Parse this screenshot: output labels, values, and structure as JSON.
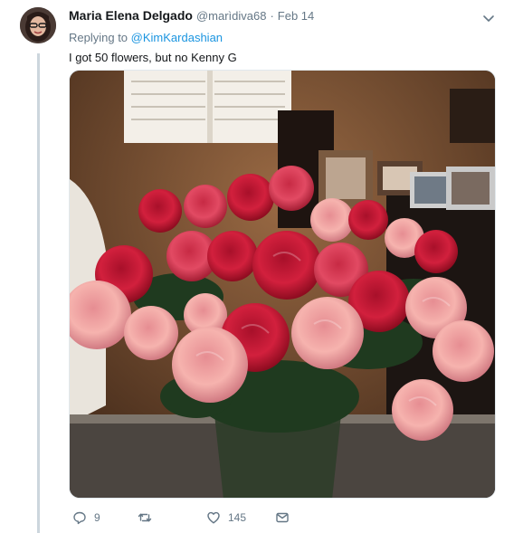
{
  "tweet": {
    "author_name": "Maria Elena Delgado",
    "author_handle": "@marìdiva68",
    "separator": "·",
    "date": "Feb 14",
    "replying_prefix": "Replying to",
    "replying_to": "@KimKardashian",
    "text": "I got 50 flowers, but no Kenny G",
    "media_alt": "Vase of red and pink roses"
  },
  "actions": {
    "reply_count": "9",
    "retweet_count": "",
    "like_count": "145"
  },
  "colors": {
    "link": "#1b95e0",
    "muted": "#657786",
    "text": "#14171a",
    "thread_line": "#ccd6dd"
  },
  "icons": {
    "reply": "reply-icon",
    "retweet": "retweet-icon",
    "like": "heart-icon",
    "message": "envelope-icon",
    "more": "chevron-down-icon"
  }
}
